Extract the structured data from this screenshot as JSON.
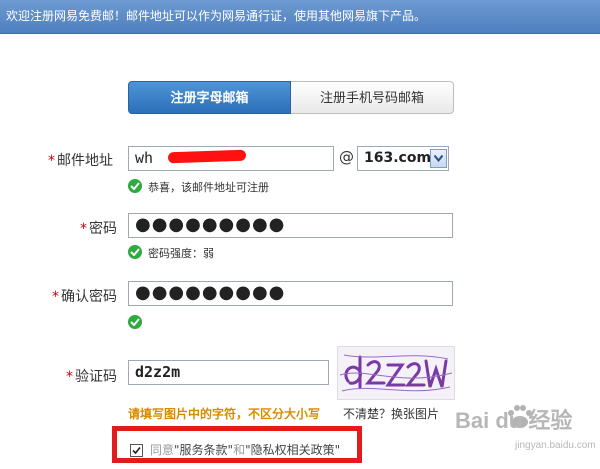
{
  "header": {
    "text": "欢迎注册网易免费邮！邮件地址可以作为网易通行证，使用其他网易旗下产品。"
  },
  "tabs": [
    {
      "label": "注册字母邮箱",
      "active": true
    },
    {
      "label": "注册手机号码邮箱",
      "active": false
    }
  ],
  "form": {
    "required_mark": "*",
    "email": {
      "label": "邮件地址",
      "value": "wh",
      "at": "@",
      "domain": "163.com",
      "status": "恭喜，该邮件地址可注册"
    },
    "password": {
      "label": "密码",
      "value": "●●●●●●●●●",
      "status": "密码强度：弱"
    },
    "confirm": {
      "label": "确认密码",
      "value": "●●●●●●●●●"
    },
    "captcha": {
      "label": "验证码",
      "value": "d2z2m",
      "hint": "请填写图片中的字符，不区分大小写",
      "refresh": "不清楚？换张图片"
    }
  },
  "agreement": {
    "prefix": "同意",
    "terms": "\"服务条款\"",
    "and": "和",
    "privacy": "\"隐私权相关政策\"",
    "checked": true
  },
  "watermark": {
    "text": "Bai du 经验",
    "url": "jingyan.baidu.com"
  },
  "colors": {
    "accent": "#2b6fb9",
    "ok": "#2eaa3f",
    "required": "#cc0000",
    "hint": "#d98b00",
    "highlight": "#e31b1b"
  }
}
